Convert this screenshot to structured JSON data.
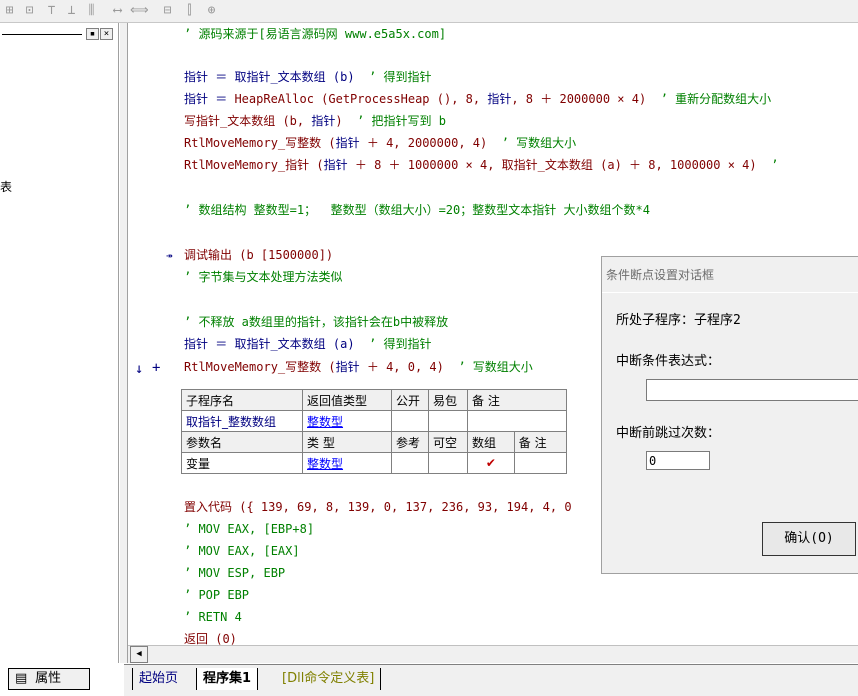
{
  "left_panel": {
    "partial_char": "表",
    "min_btn": "▪",
    "close_btn": "×",
    "properties_label": "属性"
  },
  "code": {
    "line1": "’ 源码来源于[易语言源码网 www.e5a5x.com]",
    "line2": "指针 ＝ 取指针_文本数组 (b)  ’ 得到指针",
    "line3": "指针 ＝ HeapReAlloc (GetProcessHeap (), 8, 指针, 8 ＋ 2000000 × 4)  ’ 重新分配数组大小",
    "line4": "写指针_文本数组 (b, 指针)  ’ 把指针写到 b",
    "line5": "RtlMoveMemory_写整数 (指针 ＋ 4, 2000000, 4)  ’ 写数组大小",
    "line6": "RtlMoveMemory_指针 (指针 ＋ 8 ＋ 1000000 × 4, 取指针_文本数组 (a) ＋ 8, 1000000 × 4)  ’",
    "line7": "’ 数组结构 整数型=1；  整数型（数组大小）=20；整数型文本指针 大小数组个数*4",
    "line8": "调试输出 (b [1500000])",
    "line9": "’ 字节集与文本处理方法类似",
    "line10": "’ 不释放 a数组里的指针，该指针会在b中被释放",
    "line11": "指针 ＝ 取指针_文本数组 (a)  ’ 得到指针",
    "line12": "RtlMoveMemory_写整数 (指针 ＋ 4, 0, 4)  ’ 写数组大小",
    "line13": "置入代码 ({ 139, 69, 8, 139, 0, 137, 236, 93, 194, 4, 0",
    "line14": "’ MOV EAX, [EBP+8]",
    "line15": "’ MOV EAX, [EAX]",
    "line16": "’ MOV ESP, EBP",
    "line17": "’ POP EBP",
    "line18": "’ RETN 4",
    "line19": "返回 (0)",
    "arrow_down": "↓",
    "plus": "+",
    "run_marker": "↠"
  },
  "sub_table": {
    "headers1": [
      "子程序名",
      "返回值类型",
      "公开",
      "易包",
      "备 注"
    ],
    "row1": [
      "取指针_整数数组",
      "整数型",
      "",
      "",
      ""
    ],
    "headers2": [
      "参数名",
      "类 型",
      "参考",
      "可空",
      "数组",
      "备 注"
    ],
    "row2": [
      "变量",
      "整数型",
      "",
      "",
      "✔",
      ""
    ]
  },
  "tabs": [
    "起始页",
    "程序集1",
    "[Dll命令定义表]"
  ],
  "dialog": {
    "title": "条件断点设置对话框",
    "sub_label": "所处子程序：子程序2",
    "cond_label": "中断条件表达式：",
    "cond_value": "",
    "skip_label": "中断前跳过次数：",
    "skip_value": "0",
    "ok": "确认(O)"
  },
  "colors": {
    "comment": "#008000",
    "keyword": "#000080",
    "string": "#800000"
  }
}
